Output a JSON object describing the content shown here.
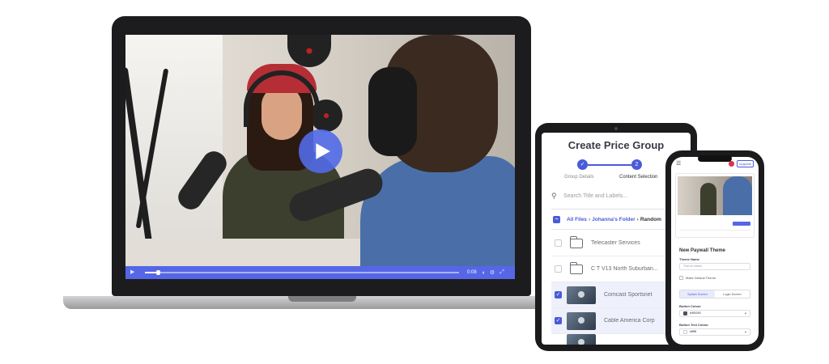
{
  "laptop": {
    "video_time": "0:08",
    "progress_fraction": 0.04,
    "controls": {
      "play_icon": "play-icon",
      "volume_icon": "volume-icon",
      "settings_icon": "settings-icon",
      "fullscreen_icon": "fullscreen-icon"
    },
    "accent_color": "#5566e6"
  },
  "tablet": {
    "title": "Create Price Group",
    "steps": [
      {
        "number": "✓",
        "label": "Group Details",
        "state": "complete"
      },
      {
        "number": "2",
        "label": "Content Selection",
        "state": "active"
      }
    ],
    "search_placeholder": "Search Title and Labels...",
    "breadcrumb": {
      "root": "All Files",
      "separator": "›",
      "middle": "Johanna's Folder",
      "last": "Random"
    },
    "rows": [
      {
        "type": "folder",
        "label": "Telecaster Services",
        "checked": false
      },
      {
        "type": "folder",
        "label": "C T V13 North Suburban...",
        "checked": false
      },
      {
        "type": "video",
        "label": "Comcast Sportsnet",
        "checked": true
      },
      {
        "type": "video",
        "label": "Cable America Corp",
        "checked": true
      }
    ],
    "accent_color": "#4a5bd8"
  },
  "phone": {
    "upgrade_label": "Upgrade",
    "section_title": "New Paywall Theme",
    "theme_name_label": "Theme Name",
    "theme_name_placeholder": "Theme Name",
    "make_default_label": "Make Default Theme",
    "tabs": [
      "Splash Screen",
      "Login Screen"
    ],
    "button_colour_label": "Button Colour",
    "button_colour_value": "#4f5260",
    "button_text_colour_label": "Button Text Colour",
    "button_text_colour_value": "#ffffff"
  }
}
